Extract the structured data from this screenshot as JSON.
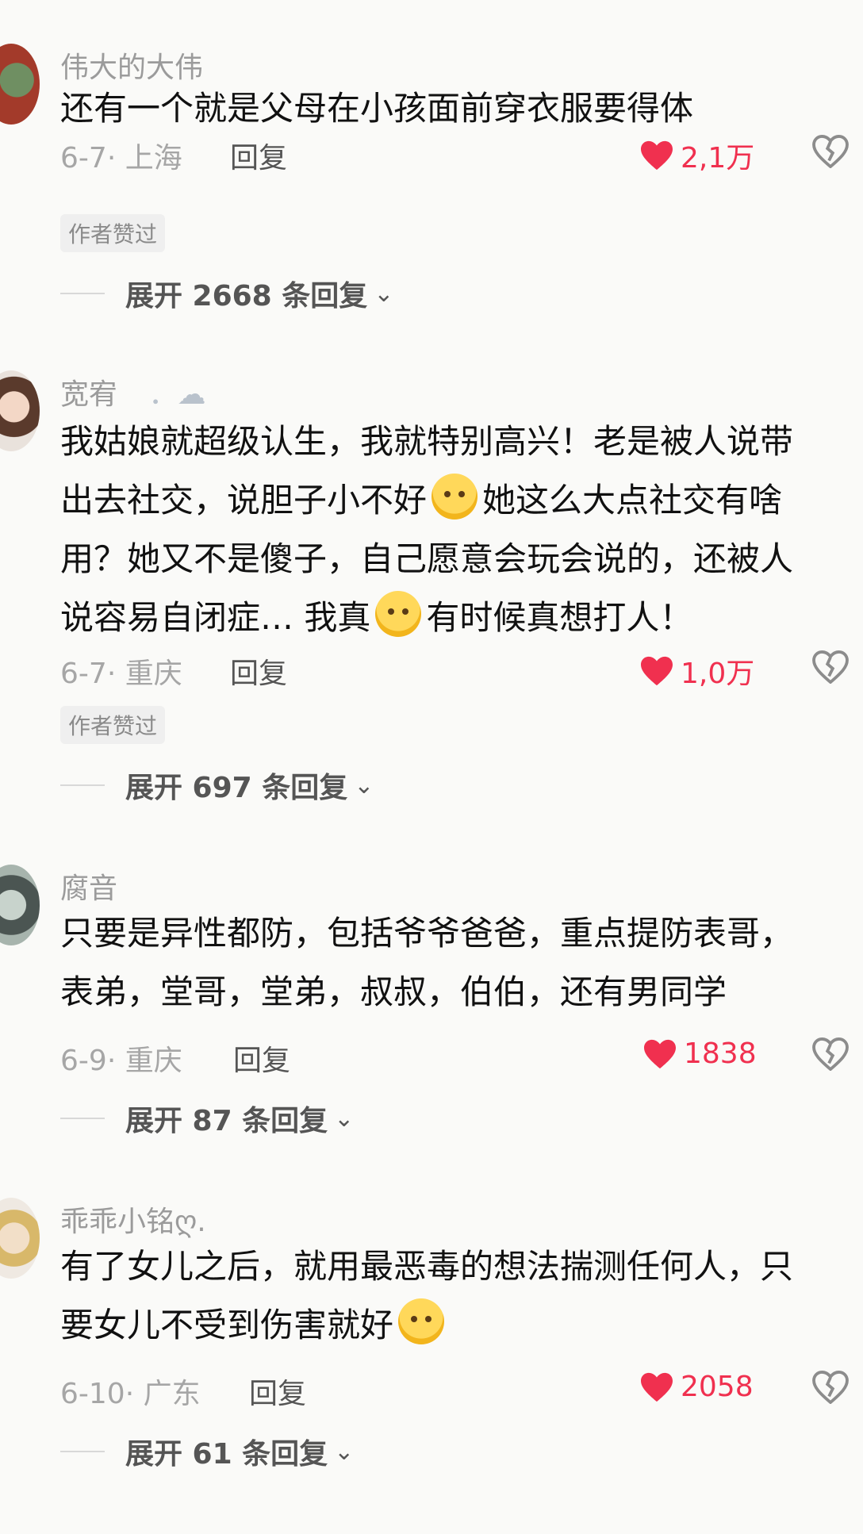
{
  "comments": [
    {
      "username": "伟大的大伟",
      "lines": [
        "还有一个就是父母在小孩面前穿衣服要得体"
      ],
      "date": "6-7",
      "location": "上海",
      "reply": "回复",
      "likes": "2,1万",
      "author_liked": "作者赞过",
      "expand_text": "展开 2668 条回复"
    },
    {
      "username": "宽宥",
      "username_suffix": "．☁",
      "lines": [
        "我姑娘就超级认生，我就特别高兴！老是被人说带",
        "出去社交，说胆子小不好",
        "她这么大点社交有啥",
        "用？她又不是傻子，自己愿意会玩会说的，还被人",
        "说容易自闭症… 我真",
        "有时候真想打人！"
      ],
      "date": "6-7",
      "location": "重庆",
      "reply": "回复",
      "likes": "1,0万",
      "author_liked": "作者赞过",
      "expand_text": "展开 697 条回复"
    },
    {
      "username": "腐音",
      "lines": [
        "只要是异性都防，包括爷爷爸爸，重点提防表哥，",
        "表弟，堂哥，堂弟，叔叔，伯伯，还有男同学"
      ],
      "date": "6-9",
      "location": "重庆",
      "reply": "回复",
      "likes": "1838",
      "expand_text": "展开 87 条回复"
    },
    {
      "username": "乖乖小铭ღ.",
      "lines": [
        "有了女儿之后，就用最恶毒的想法揣测任何人，只",
        "要女儿不受到伤害就好"
      ],
      "date": "6-10",
      "location": "广东",
      "reply": "回复",
      "likes": "2058",
      "expand_text": "展开 61 条回复"
    }
  ],
  "colors": {
    "like_red": "#f0304f",
    "background": "#fafaf8"
  },
  "icons": {
    "like": "heart-icon",
    "dislike": "broken-heart-icon",
    "expand": "chevron-down-icon"
  }
}
